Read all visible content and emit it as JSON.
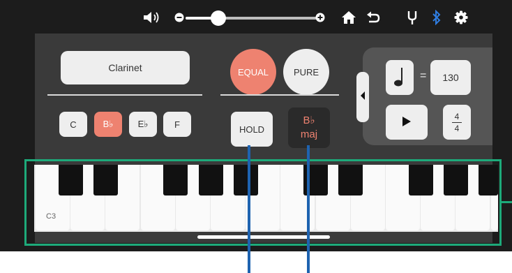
{
  "topbar": {
    "volume_icon": "speaker-icon",
    "volume_minus_icon": "minus-circle-icon",
    "volume_level": 0.25,
    "volume_plus_icon": "plus-circle-icon",
    "home_icon": "home-icon",
    "undo_icon": "undo-icon",
    "tuner_icon": "tuning-fork-icon",
    "bluetooth_icon": "bluetooth-icon",
    "settings_icon": "gear-icon",
    "bluetooth_color": "#2f7de1"
  },
  "instrument": {
    "label": "Clarinet"
  },
  "keys": [
    {
      "label": "C",
      "active": false
    },
    {
      "label": "B♭",
      "active": true
    },
    {
      "label": "E♭",
      "active": false
    },
    {
      "label": "F",
      "active": false
    }
  ],
  "tuning": {
    "equal_label": "EQUAL",
    "pure_label": "PURE",
    "selected": "EQUAL"
  },
  "hold": {
    "label": "HOLD"
  },
  "chord": {
    "root": "B♭",
    "quality": "maj"
  },
  "metronome": {
    "collapse_icon": "chevron-left-icon",
    "note_icon": "quarter-note-icon",
    "equals": "=",
    "tempo": "130",
    "play_icon": "play-icon",
    "time_sig_top": "4",
    "time_sig_bottom": "4"
  },
  "keyboard": {
    "start_label": "C3"
  },
  "colors": {
    "accent": "#ee8270",
    "panel": "#3a3a3a",
    "background": "#1c1c1c",
    "annotation_box": "#1daa7a",
    "annotation_line": "#1e63b0"
  }
}
